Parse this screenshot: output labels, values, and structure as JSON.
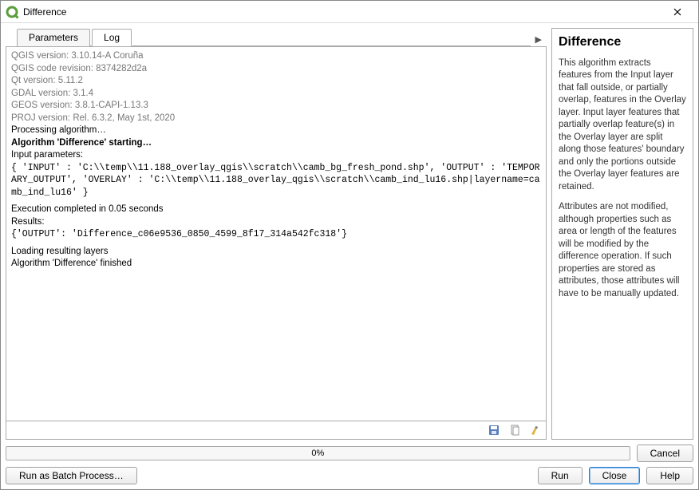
{
  "window": {
    "title": "Difference"
  },
  "tabs": {
    "parameters": "Parameters",
    "log": "Log"
  },
  "log": {
    "qgis_version": "QGIS version: 3.10.14-A Coruña",
    "code_rev": "QGIS code revision: 8374282d2a",
    "qt_version": "Qt version: 5.11.2",
    "gdal_version": "GDAL version: 3.1.4",
    "geos_version": "GEOS version: 3.8.1-CAPI-1.13.3",
    "proj_version": "PROJ version: Rel. 6.3.2, May 1st, 2020",
    "processing": "Processing algorithm…",
    "starting": "Algorithm 'Difference' starting…",
    "input_label": "Input parameters:",
    "input_line": "{ 'INPUT' : 'C:\\\\temp\\\\11.188_overlay_qgis\\\\scratch\\\\camb_bg_fresh_pond.shp', 'OUTPUT' : 'TEMPORARY_OUTPUT', 'OVERLAY' : 'C:\\\\temp\\\\11.188_overlay_qgis\\\\scratch\\\\camb_ind_lu16.shp|layername=camb_ind_lu16' }",
    "exec_done": "Execution completed in 0.05 seconds",
    "results_label": "Results:",
    "results_line": "{'OUTPUT': 'Difference_c06e9536_0850_4599_8f17_314a542fc318'}",
    "loading": "Loading resulting layers",
    "finished": "Algorithm 'Difference' finished"
  },
  "help": {
    "title": "Difference",
    "p1": "This algorithm extracts features from the Input layer that fall outside, or partially overlap, features in the Overlay layer. Input layer features that partially overlap feature(s) in the Overlay layer are split along those features' boundary and only the portions outside the Overlay layer features are retained.",
    "p2": "Attributes are not modified, although properties such as area or length of the features will be modified by the difference operation. If such properties are stored as attributes, those attributes will have to be manually updated."
  },
  "progress": {
    "text": "0%"
  },
  "buttons": {
    "cancel": "Cancel",
    "batch": "Run as Batch Process…",
    "run": "Run",
    "close": "Close",
    "help": "Help"
  }
}
